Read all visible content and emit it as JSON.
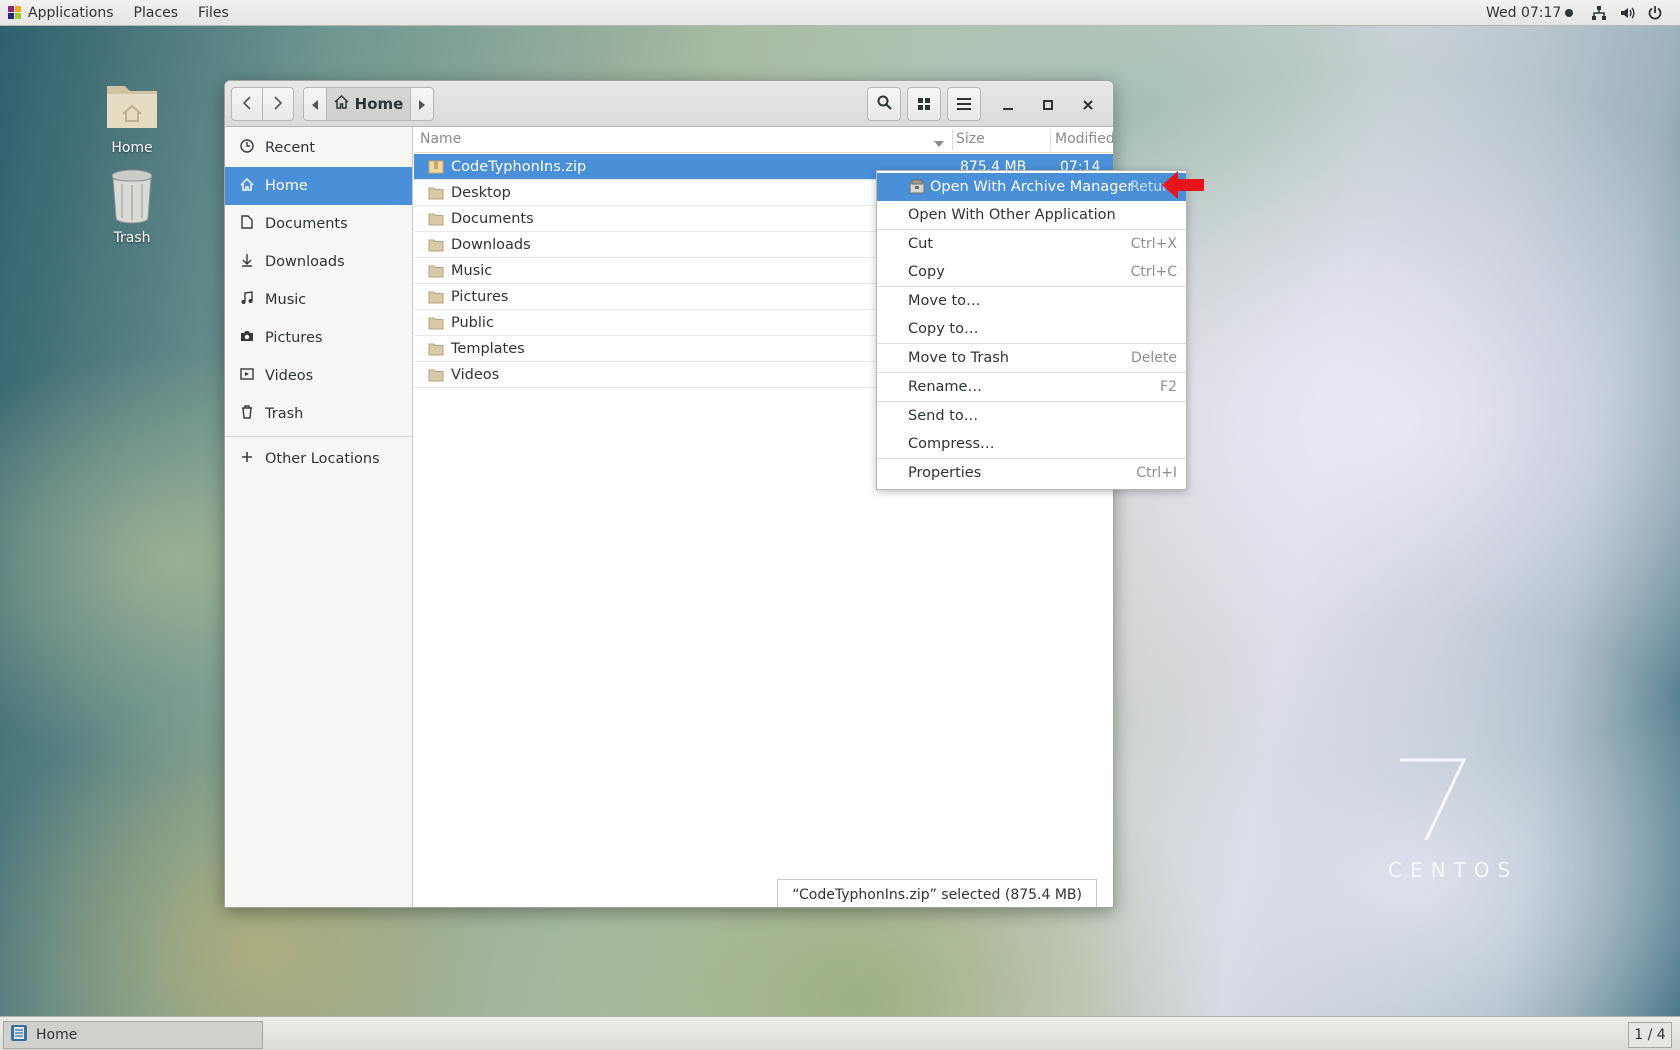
{
  "topbar": {
    "menus": [
      "Applications",
      "Places",
      "Files"
    ],
    "clock": "Wed 07:17",
    "tray_icons": [
      "network-icon",
      "volume-icon",
      "power-icon"
    ]
  },
  "desktop": {
    "icons": [
      {
        "label": "Home",
        "icon": "home-folder-icon"
      },
      {
        "label": "Trash",
        "icon": "trash-can-icon"
      }
    ]
  },
  "watermark": {
    "number": "7",
    "word": "CENTOS"
  },
  "window": {
    "path_label": "Home",
    "sidebar": [
      {
        "label": "Recent",
        "icon": "clock-icon"
      },
      {
        "label": "Home",
        "icon": "home-icon",
        "active": true
      },
      {
        "label": "Documents",
        "icon": "document-icon"
      },
      {
        "label": "Downloads",
        "icon": "download-icon"
      },
      {
        "label": "Music",
        "icon": "music-icon"
      },
      {
        "label": "Pictures",
        "icon": "camera-icon"
      },
      {
        "label": "Videos",
        "icon": "video-icon"
      },
      {
        "label": "Trash",
        "icon": "trash-icon"
      },
      {
        "label": "Other Locations",
        "icon": "plus-icon"
      }
    ],
    "columns": {
      "name": "Name",
      "size": "Size",
      "modified": "Modified"
    },
    "files": [
      {
        "name": "CodeTyphonIns.zip",
        "size": "875.4 MB",
        "modified": "07:14",
        "type": "zip",
        "selected": true
      },
      {
        "name": "Desktop",
        "type": "folder"
      },
      {
        "name": "Documents",
        "type": "folder"
      },
      {
        "name": "Downloads",
        "type": "folder"
      },
      {
        "name": "Music",
        "type": "folder"
      },
      {
        "name": "Pictures",
        "type": "folder"
      },
      {
        "name": "Public",
        "type": "folder"
      },
      {
        "name": "Templates",
        "type": "folder"
      },
      {
        "name": "Videos",
        "type": "folder"
      }
    ],
    "status": "“CodeTyphonIns.zip” selected  (875.4 MB)"
  },
  "context_menu": {
    "items": [
      {
        "label": "Open With Archive Manager",
        "accel": "Return",
        "highlighted": true
      },
      {
        "label": "Open With Other Application",
        "accel": ""
      },
      {
        "sep": true
      },
      {
        "label": "Cut",
        "accel": "Ctrl+X"
      },
      {
        "label": "Copy",
        "accel": "Ctrl+C"
      },
      {
        "sep": true
      },
      {
        "label": "Move to…",
        "accel": ""
      },
      {
        "label": "Copy to…",
        "accel": ""
      },
      {
        "sep": true
      },
      {
        "label": "Move to Trash",
        "accel": "Delete"
      },
      {
        "sep": true
      },
      {
        "label": "Rename…",
        "accel": "F2"
      },
      {
        "sep": true
      },
      {
        "label": "Send to…",
        "accel": ""
      },
      {
        "label": "Compress…",
        "accel": ""
      },
      {
        "sep": true
      },
      {
        "label": "Properties",
        "accel": "Ctrl+I"
      }
    ]
  },
  "taskbar": {
    "task_label": "Home",
    "workspace": "1 / 4"
  },
  "colors": {
    "accent": "#4a90d9",
    "annotation_arrow": "#e8141c"
  }
}
